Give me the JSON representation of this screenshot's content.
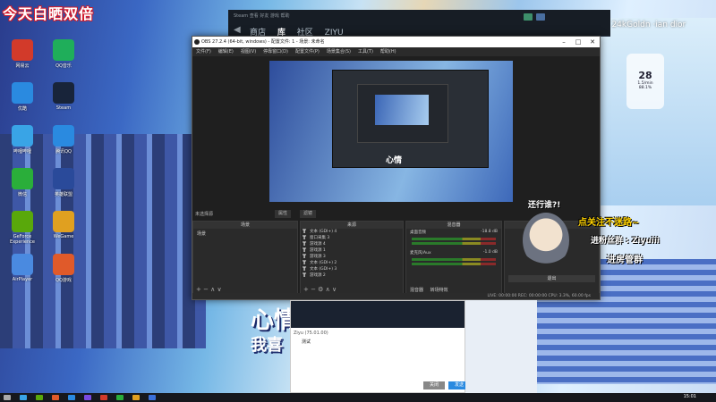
{
  "overlay": {
    "banner": "今天白晒双倍",
    "mood": "Mood - 24kGoldn ·ian dior",
    "followup": "还行谁?!",
    "follow": "点关注不迷路~",
    "fan_group": "进粉丝群 : Ziyuiii",
    "room_group": "进房管群",
    "weather_temp": "28",
    "weather_sub": "1.5/min",
    "weather_pct": "88.1%"
  },
  "desktop_icons": [
    {
      "label": "网易云",
      "color": "#d23a2a"
    },
    {
      "label": "QQ音乐",
      "color": "#1fae5a"
    },
    {
      "label": "优酷",
      "color": "#2a8ae0"
    },
    {
      "label": "Steam",
      "color": "#18243a"
    },
    {
      "label": "哔哩哔哩",
      "color": "#39a4e6"
    },
    {
      "label": "腾讯QQ",
      "color": "#2a8ae0"
    },
    {
      "label": "微信",
      "color": "#2aae3a"
    },
    {
      "label": "英雄联盟",
      "color": "#2a4a9a"
    },
    {
      "label": "GeForce Experience",
      "color": "#59a80b"
    },
    {
      "label": "WeGame",
      "color": "#e0a020"
    },
    {
      "label": "AirPlayer",
      "color": "#4a8ae0"
    },
    {
      "label": "QQ游戏",
      "color": "#e05a2a"
    }
  ],
  "steam": {
    "top_text": "Steam  查看  好友  游戏  帮助",
    "nav": [
      "商店",
      "库",
      "社区",
      "ZIYU"
    ]
  },
  "obs": {
    "title": "OBS 27.2.4 (64-bit, windows) - 配置文件: 1 - 场景: 未命名",
    "menu": [
      "文件(F)",
      "编辑(E)",
      "视图(V)",
      "停靠窗口(D)",
      "配置文件(P)",
      "场景集合(S)",
      "工具(T)",
      "帮助(H)"
    ],
    "preview_text": "心情",
    "no_source": "未选择源",
    "props": "属性",
    "filters": "滤镜",
    "docks": {
      "scenes": {
        "title": "场景",
        "items": [
          "场景"
        ]
      },
      "sources": {
        "title": "来源",
        "items": [
          "文本 (GDI+) 4",
          "窗口采集 3",
          "游戏源 4",
          "游戏源 1",
          "游戏源 3",
          "文本 (GDI+) 2",
          "文本 (GDI+) 3",
          "游戏源 2"
        ]
      },
      "mixer": {
        "title": "混音器",
        "tracks": [
          "桌面音频",
          "麦克风/Aux"
        ],
        "levels": [
          "-18.8 dB",
          "-1.0 dB"
        ],
        "tabs": [
          "混音器",
          "转场特效"
        ]
      },
      "controls": {
        "title": "控件",
        "button": "退出"
      }
    },
    "status": "LIVE: 00:00:00   REC: 00:00:00   CPU: 3.3%, 60.00 fps"
  },
  "chat": {
    "name": "Ziyu (75.01.00)",
    "message": "测试",
    "send": "发送",
    "close": "关闭"
  },
  "big_text": {
    "line1": "心情",
    "line2": "我喜"
  },
  "taskbar": {
    "clock": "15:01",
    "icons": [
      "#3a6fd8",
      "#e0a020",
      "#2aae3a",
      "#d23a2a",
      "#7a4ae0",
      "#2a8ae0",
      "#e05a2a",
      "#59a80b",
      "#39a4e6",
      "#aaaaaa"
    ]
  }
}
